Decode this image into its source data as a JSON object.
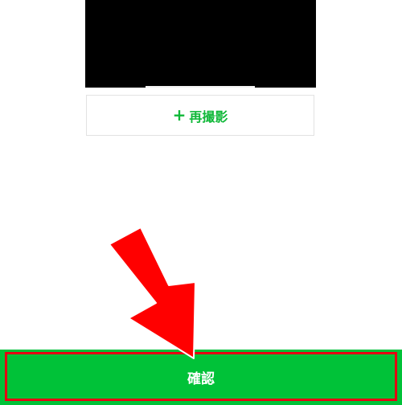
{
  "preview": {
    "image_color": "#000000"
  },
  "retake": {
    "icon": "+",
    "label": "再撮影",
    "color": "#0fb838"
  },
  "confirm": {
    "label": "確認",
    "background": "#00c238"
  },
  "annotation": {
    "arrow_color": "#ff0000",
    "highlight_color": "#e60012"
  }
}
